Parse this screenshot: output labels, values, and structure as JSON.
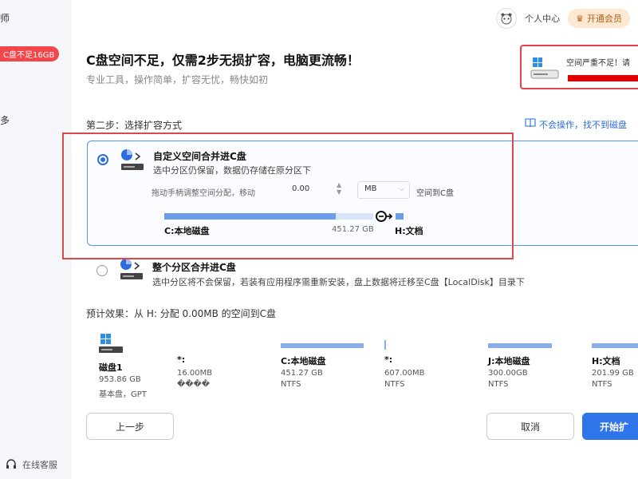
{
  "sidebar": {
    "title_fragment": "师",
    "badge": "C盘不足16GB",
    "more_fragment": "多",
    "support_label": "在线客服"
  },
  "header": {
    "user_center": "个人中心",
    "vip_label": "开通会员"
  },
  "main": {
    "title": "C盘空间不足，仅需2步无损扩容，电脑更流畅！",
    "subtitle": "专业工具，操作简单，扩容无忧，畅快如初"
  },
  "warning_card": {
    "text": "空间严重不足！请"
  },
  "step": {
    "label": "第二步：选择扩容方式",
    "help_link": "不会操作，找不到磁盘"
  },
  "option1": {
    "title": "自定义空间合并进C盘",
    "desc": "选中分区仍保留，数据仍存储在原分区下",
    "drag_hint": "拖动手柄调整空间分配，移动",
    "amount": "0.00",
    "unit": "MB",
    "space_to": "空间到C盘",
    "c_drive_label": "C:本地磁盘",
    "c_drive_size": "451.27 GB",
    "h_drive_label": "H:文档",
    "fill_fraction": 0.82
  },
  "option2": {
    "title": "整个分区合并进C盘",
    "desc": "选中分区将不会保留，若装有应用程序需重新安装，盘上数据将迁移至C盘【LocalDisk】目录下"
  },
  "preview": {
    "label": "预计效果：从 H: 分配 0.00MB 的空间到C盘"
  },
  "disk0": {
    "name": "磁盘1",
    "size": "953.86 GB",
    "type": "基本盘，GPT"
  },
  "partitions": [
    {
      "name": "*:",
      "size": "16.00MB",
      "fs": "����"
    },
    {
      "name": "C:本地磁盘",
      "size": "451.27 GB",
      "fs": "NTFS"
    },
    {
      "name": "*:",
      "size": "607.00MB",
      "fs": "NTFS"
    },
    {
      "name": "J:本地磁盘",
      "size": "300.00GB",
      "fs": "NTFS"
    },
    {
      "name": "H:文档",
      "size": "201.99 GB",
      "fs": "NTFS"
    }
  ],
  "buttons": {
    "prev": "上一步",
    "cancel": "取消",
    "start": "开始扩"
  },
  "colors": {
    "accent": "#2f74e8",
    "danger": "#e04848",
    "bar": "#6c9de8"
  }
}
